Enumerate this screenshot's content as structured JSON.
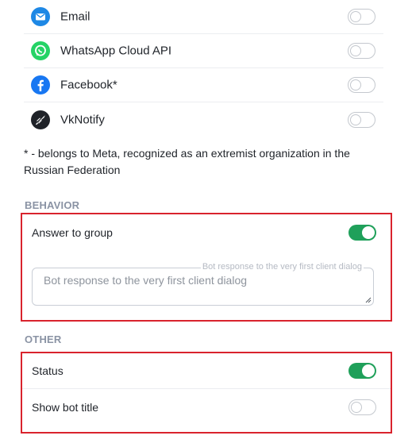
{
  "channels": [
    {
      "label": "Email",
      "icon": "email-icon",
      "color": "#1e88e5",
      "enabled": false
    },
    {
      "label": "WhatsApp Cloud API",
      "icon": "whatsapp-icon",
      "color": "#25d366",
      "enabled": false
    },
    {
      "label": "Facebook*",
      "icon": "facebook-icon",
      "color": "#1877f2",
      "enabled": false
    },
    {
      "label": "VkNotify",
      "icon": "vknotify-icon",
      "color": "#1f2228",
      "enabled": false
    }
  ],
  "footnote": "* - belongs to Meta, recognized as an extremist organization in the Russian Federation",
  "behavior": {
    "title": "BEHAVIOR",
    "answer_to_group": {
      "label": "Answer to group",
      "enabled": true
    },
    "bot_response": {
      "floating_label": "Bot response to the very first client dialog",
      "placeholder": "Bot response to the very first client dialog",
      "value": ""
    }
  },
  "other": {
    "title": "OTHER",
    "status": {
      "label": "Status",
      "enabled": true
    },
    "show_bot_title": {
      "label": "Show bot title",
      "enabled": false
    }
  },
  "colors": {
    "accent_green": "#1fa05a",
    "highlight_red": "#d9232d",
    "section_title": "#8a93a4"
  }
}
